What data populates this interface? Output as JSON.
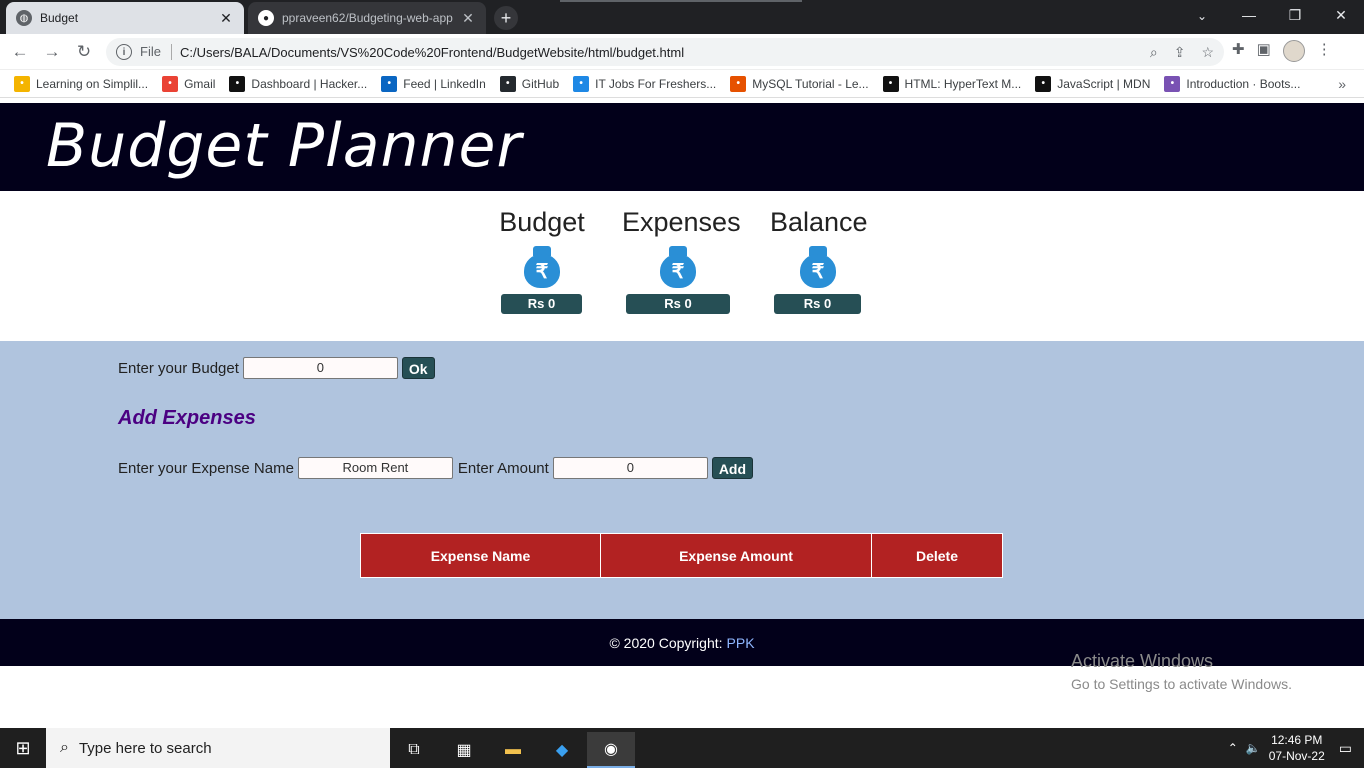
{
  "browser": {
    "tabs": [
      {
        "title": "Budget",
        "active": true
      },
      {
        "title": "ppraveen62/Budgeting-web-app",
        "active": false
      }
    ],
    "url_scheme": "File",
    "url": "C:/Users/BALA/Documents/VS%20Code%20Frontend/BudgetWebsite/html/budget.html",
    "bookmarks": [
      {
        "label": "Learning on Simplil...",
        "icon": "simplilearn-icon",
        "color": "#f4b400"
      },
      {
        "label": "Gmail",
        "icon": "gmail-icon",
        "color": "#ea4335"
      },
      {
        "label": "Dashboard | Hacker...",
        "icon": "hackerrank-icon",
        "color": "#111111"
      },
      {
        "label": "Feed | LinkedIn",
        "icon": "linkedin-icon",
        "color": "#0a66c2"
      },
      {
        "label": "GitHub",
        "icon": "github-icon",
        "color": "#24292e"
      },
      {
        "label": "IT Jobs For Freshers...",
        "icon": "jobs-icon",
        "color": "#1e88e5"
      },
      {
        "label": "MySQL Tutorial - Le...",
        "icon": "mysql-icon",
        "color": "#e65100"
      },
      {
        "label": "HTML: HyperText M...",
        "icon": "mdn-icon",
        "color": "#111111"
      },
      {
        "label": "JavaScript | MDN",
        "icon": "mdn-icon",
        "color": "#111111"
      },
      {
        "label": "Introduction · Boots...",
        "icon": "bootstrap-icon",
        "color": "#7952b3"
      }
    ]
  },
  "page": {
    "title": "Budget Planner",
    "summary": [
      {
        "label": "Budget",
        "amount": "Rs 0"
      },
      {
        "label": "Expenses",
        "amount": "Rs 0"
      },
      {
        "label": "Balance",
        "amount": "Rs 0"
      }
    ],
    "budget_form": {
      "label": "Enter your Budget",
      "value": "0",
      "button": "Ok"
    },
    "add_expenses_title": "Add Expenses",
    "expense_form": {
      "name_label": "Enter your Expense Name",
      "name_value": "Room Rent",
      "amount_label": "Enter Amount",
      "amount_value": "0",
      "button": "Add"
    },
    "table_headers": [
      "Expense Name",
      "Expense Amount",
      "Delete"
    ],
    "footer": {
      "text": "© 2020 Copyright:",
      "link": "PPK"
    },
    "watermark": {
      "line1": "Activate Windows",
      "line2": "Go to Settings to activate Windows."
    }
  },
  "taskbar": {
    "search_placeholder": "Type here to search",
    "time": "12:46 PM",
    "date": "07-Nov-22"
  },
  "colors": {
    "banner": "#02001a",
    "form_bg": "#b0c4de",
    "button": "#264f55",
    "table_header": "#b22222",
    "add_title": "#4b0082"
  }
}
